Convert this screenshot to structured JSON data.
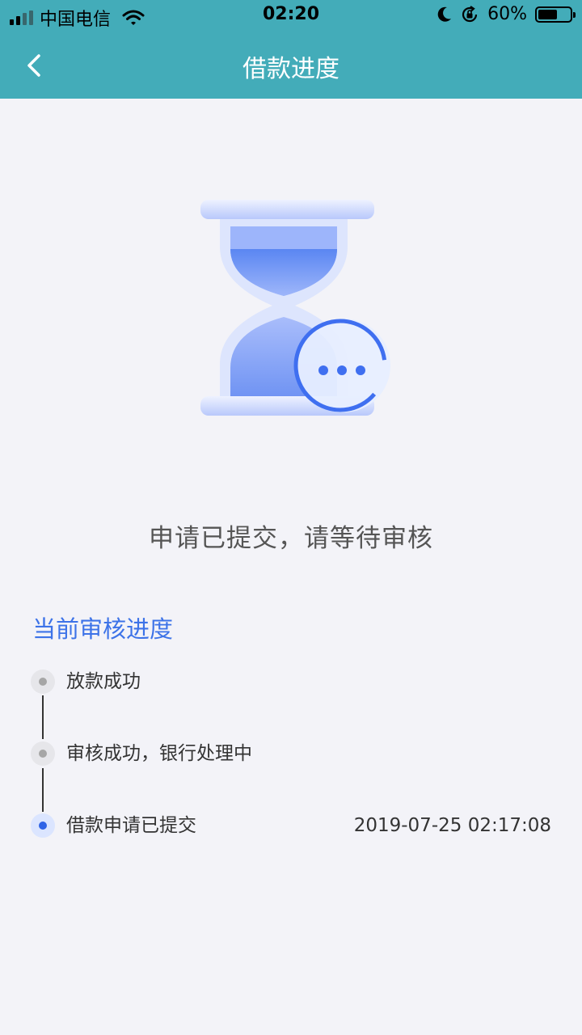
{
  "status_bar": {
    "carrier": "中国电信",
    "time": "02:20",
    "battery": "60%",
    "battery_level": 0.6
  },
  "nav": {
    "title": "借款进度"
  },
  "main": {
    "message": "申请已提交，请等待审核",
    "progress_title": "当前审核进度",
    "steps": [
      {
        "label": "放款成功",
        "time": "",
        "active": false
      },
      {
        "label": "审核成功，银行处理中",
        "time": "",
        "active": false
      },
      {
        "label": "借款申请已提交",
        "time": "2019-07-25 02:17:08",
        "active": true
      }
    ]
  },
  "colors": {
    "header": "#43acb9",
    "accent": "#3d73e8",
    "background": "#f3f3f8"
  }
}
